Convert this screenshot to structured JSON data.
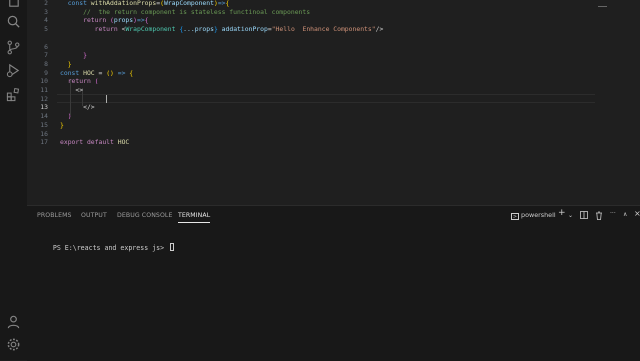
{
  "activity_bar": {
    "icons": [
      "files-icon",
      "search-icon",
      "source-control-icon",
      "run-debug-icon",
      "extensions-icon",
      "account-icon",
      "settings-gear-icon"
    ]
  },
  "editor": {
    "lines": [
      {
        "num": "2",
        "segments": [
          [
            "  ",
            "pn"
          ],
          [
            "const ",
            "kw"
          ],
          [
            "withAddationProps",
            "fn"
          ],
          [
            "=",
            "op"
          ],
          [
            "(",
            "br1"
          ],
          [
            "WrapComponent",
            "var"
          ],
          [
            ")",
            "br1"
          ],
          [
            "=>",
            "kw"
          ],
          [
            "{",
            "br1"
          ]
        ]
      },
      {
        "num": "3",
        "segments": [
          [
            "      //  the return component is stateless functinoal components",
            "cm"
          ]
        ]
      },
      {
        "num": "4",
        "segments": [
          [
            "      ",
            "pn"
          ],
          [
            "return ",
            "kw2"
          ],
          [
            "(",
            "br2"
          ],
          [
            "props",
            "var"
          ],
          [
            ")",
            "br2"
          ],
          [
            "=>",
            "kw"
          ],
          [
            "{",
            "br2"
          ]
        ]
      },
      {
        "num": "5",
        "segments": [
          [
            "         ",
            "pn"
          ],
          [
            "return ",
            "kw2"
          ],
          [
            "<",
            "op"
          ],
          [
            "WrapComponent",
            "tg"
          ],
          [
            " {",
            "br3"
          ],
          [
            "...props",
            "var"
          ],
          [
            "}",
            "br3"
          ],
          [
            " addationProp",
            "var"
          ],
          [
            "=",
            "op"
          ],
          [
            "\"Hello  Enhance Components\"",
            "st"
          ],
          [
            "/>",
            "op"
          ]
        ]
      },
      {
        "num": "6",
        "segments": [
          [
            "",
            "pn"
          ]
        ]
      },
      {
        "num": "7",
        "segments": [
          [
            "      ",
            "pn"
          ],
          [
            "}",
            "br2"
          ]
        ]
      },
      {
        "num": "8",
        "segments": [
          [
            "  ",
            "pn"
          ],
          [
            "}",
            "br1"
          ]
        ]
      },
      {
        "num": "9",
        "segments": [
          [
            "const ",
            "kw"
          ],
          [
            "HOC",
            "fn"
          ],
          [
            " = ",
            "op"
          ],
          [
            "()",
            "br1"
          ],
          [
            " => ",
            "kw"
          ],
          [
            "{",
            "br1"
          ]
        ]
      },
      {
        "num": "10",
        "segments": [
          [
            "  ",
            "pn"
          ],
          [
            "return ",
            "kw2"
          ],
          [
            "(",
            "br2"
          ]
        ]
      },
      {
        "num": "11",
        "segments": [
          [
            "    ",
            "pn"
          ],
          [
            "<>",
            "op"
          ]
        ]
      },
      {
        "num": "12",
        "segments": [
          [
            "",
            "pn"
          ]
        ]
      },
      {
        "num": "13",
        "segments": [
          [
            "      ",
            "pn"
          ],
          [
            "</>",
            "op"
          ]
        ]
      },
      {
        "num": "14",
        "segments": [
          [
            "  ",
            "pn"
          ],
          [
            ")",
            "br2"
          ]
        ]
      },
      {
        "num": "15",
        "segments": [
          [
            "}",
            "br1"
          ]
        ]
      },
      {
        "num": "16",
        "segments": [
          [
            "",
            "pn"
          ]
        ]
      },
      {
        "num": "17",
        "segments": [
          [
            "export ",
            "kw2"
          ],
          [
            "default ",
            "kw2"
          ],
          [
            "HOC",
            "fn"
          ]
        ]
      }
    ],
    "active_line": "13"
  },
  "panel": {
    "tabs": [
      "PROBLEMS",
      "OUTPUT",
      "DEBUG CONSOLE",
      "TERMINAL"
    ],
    "active_tab": "TERMINAL",
    "terminal_name": "powershell",
    "terminal_prompt": "PS E:\\reacts and express js> "
  }
}
